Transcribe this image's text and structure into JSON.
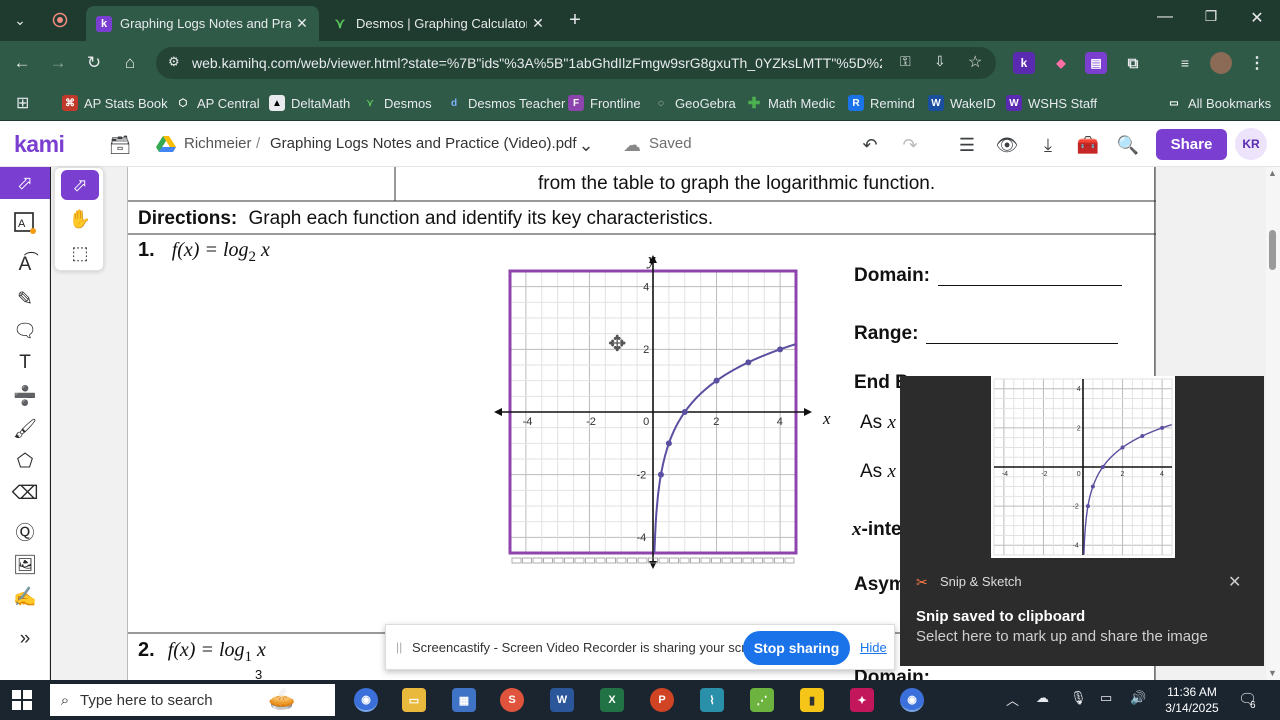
{
  "browser": {
    "tabs": [
      {
        "label": "Graphing Logs Notes and Practice",
        "active": true,
        "favicon": "kami-icon"
      },
      {
        "label": "Desmos | Graphing Calculator",
        "active": false,
        "favicon": "desmos-icon"
      }
    ],
    "url": "web.kamihq.com/web/viewer.html?state=%7B\"ids\"%3A%5B\"1abGhdIlzFmgw9srG8gxuTh_0YZksLMTT\"%5D%2C...",
    "bookmarks": [
      "AP Stats Book",
      "AP Central",
      "DeltaMath",
      "Desmos",
      "Desmos Teacher",
      "Frontline",
      "GeoGebra",
      "Math Medic",
      "Remind",
      "WakeID",
      "WSHS Staff"
    ],
    "all_bookmarks": "All Bookmarks"
  },
  "kami": {
    "logo": "kami",
    "folder": "Richmeier",
    "separator": "/",
    "filename": "Graphing Logs Notes and Practice (Video).pdf",
    "saved": "Saved",
    "share": "Share",
    "avatar": "KR"
  },
  "document": {
    "top_text": "from the table to graph the logarithmic function.",
    "directions_label": "Directions:",
    "directions_text": "Graph each function and identify its key characteristics.",
    "problem1": {
      "number": "1.",
      "func_pre": "f(x) = log",
      "base": "2",
      "func_post": " x"
    },
    "problem2": {
      "number": "2.",
      "func_pre": "f(x) = log",
      "base": "1",
      "base_den": "3",
      "func_post": " x"
    },
    "fields": {
      "domain": "Domain:",
      "range": "Range:",
      "end_behavior": "End B",
      "as1": "As",
      "as2": "As",
      "x_var": "x",
      "x_int": "-inte",
      "asym": "Asym",
      "domain2": "Domain:"
    },
    "graph": {
      "axis_x": "x",
      "axis_y": "y",
      "x_ticks": [
        "-4",
        "-2",
        "0",
        "2",
        "4"
      ],
      "y_ticks": [
        "4",
        "2",
        "-2",
        "-4"
      ]
    }
  },
  "chart_data": {
    "type": "line",
    "title": "",
    "xlabel": "x",
    "ylabel": "y",
    "xlim": [
      -4.5,
      4.5
    ],
    "ylim": [
      -4.5,
      4.5
    ],
    "grid": true,
    "series": [
      {
        "function": "log2(x)",
        "points": [
          [
            0.25,
            -2
          ],
          [
            0.5,
            -1
          ],
          [
            1,
            0
          ],
          [
            2,
            1
          ],
          [
            3,
            1.585
          ],
          [
            4,
            2
          ]
        ]
      }
    ]
  },
  "notification": {
    "app": "Snip & Sketch",
    "title": "Snip saved to clipboard",
    "message": "Select here to mark up and share the image"
  },
  "screencastify": {
    "text": "Screencastify - Screen Video Recorder is sharing your screen.",
    "stop": "Stop sharing",
    "hide": "Hide"
  },
  "taskbar": {
    "search_placeholder": "Type here to search",
    "time": "11:36 AM",
    "date": "3/14/2025",
    "notif_count": "6"
  },
  "colors": {
    "kami_purple": "#7a3fd1",
    "curve": "#5a4fa0",
    "chrome_green": "#2f5a47"
  }
}
